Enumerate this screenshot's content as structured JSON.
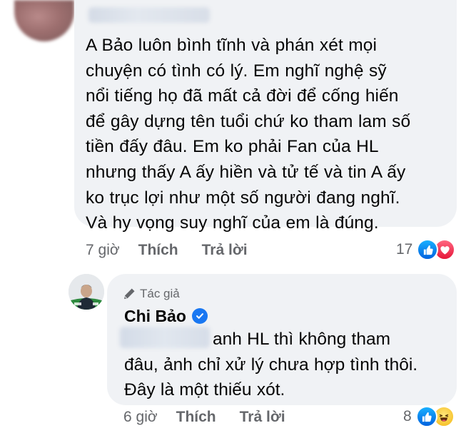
{
  "comment": {
    "text": "A Bảo luôn bình tĩnh và phán xét mọi\nchuyện có tình có lý. Em nghĩ nghệ sỹ\nnổi tiếng họ đã mất cả đời để cống hiến\nđể gây dựng tên tuổi chứ ko tham lam số\ntiền đấy đâu. Em ko phải Fan của HL\nnhưng thấy A ấy hiền và tử tế  và tin A ấy\nko trục lợi như một số người đang nghĩ.\nVà hy vọng suy nghĩ của em là đúng.",
    "time": "7 giờ",
    "like_label": "Thích",
    "reply_label": "Trả lời",
    "reaction_count": "17",
    "reactions": [
      "like",
      "love"
    ]
  },
  "reply": {
    "author_tag": "Tác giả",
    "author_name": "Chi Bảo",
    "verified": true,
    "text_line1": "anh HL thì không tham",
    "text_rest": "đâu, ảnh chỉ xử lý chưa hợp tình thôi.\nĐây là một thiếu xót.",
    "time": "6 giờ",
    "like_label": "Thích",
    "reply_label": "Trả lời",
    "reaction_count": "8",
    "reactions": [
      "like",
      "haha"
    ]
  },
  "colors": {
    "bubble": "#f0f2f5",
    "secondary_text": "#65676b",
    "like_blue": "#1877f2",
    "love_red": "#f33e58",
    "haha_yellow": "#f7c531"
  }
}
